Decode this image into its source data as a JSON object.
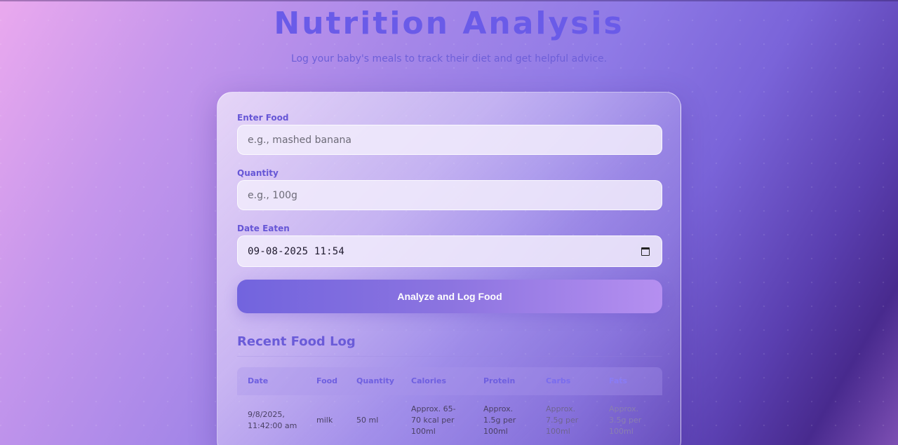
{
  "header": {
    "title": "Nutrition Analysis",
    "subtitle": "Log your baby's meals to track their diet and get helpful advice."
  },
  "form": {
    "food": {
      "label": "Enter Food",
      "placeholder": "e.g., mashed banana"
    },
    "quantity": {
      "label": "Quantity",
      "placeholder": "e.g., 100g"
    },
    "date": {
      "label": "Date Eaten",
      "value": "09-08-2025 11:54"
    },
    "submit_label": "Analyze and Log Food"
  },
  "log": {
    "title": "Recent Food Log",
    "columns": [
      "Date",
      "Food",
      "Quantity",
      "Calories",
      "Protein",
      "Carbs",
      "Fats"
    ],
    "rows": [
      {
        "date": "9/8/2025, 11:42:00 am",
        "food": "milk",
        "quantity": "50 ml",
        "calories": "Approx. 65-70 kcal per 100ml",
        "protein": "Approx. 1.5g per 100ml",
        "carbs": "Approx. 7.5g per 100ml",
        "fats": "Approx. 3.5g per 100ml"
      }
    ]
  },
  "icons": {
    "date_picker": "calendar-icon"
  },
  "colors": {
    "accent": "#6a5be8",
    "button_start": "#7264de",
    "button_end": "#b58ff0"
  }
}
